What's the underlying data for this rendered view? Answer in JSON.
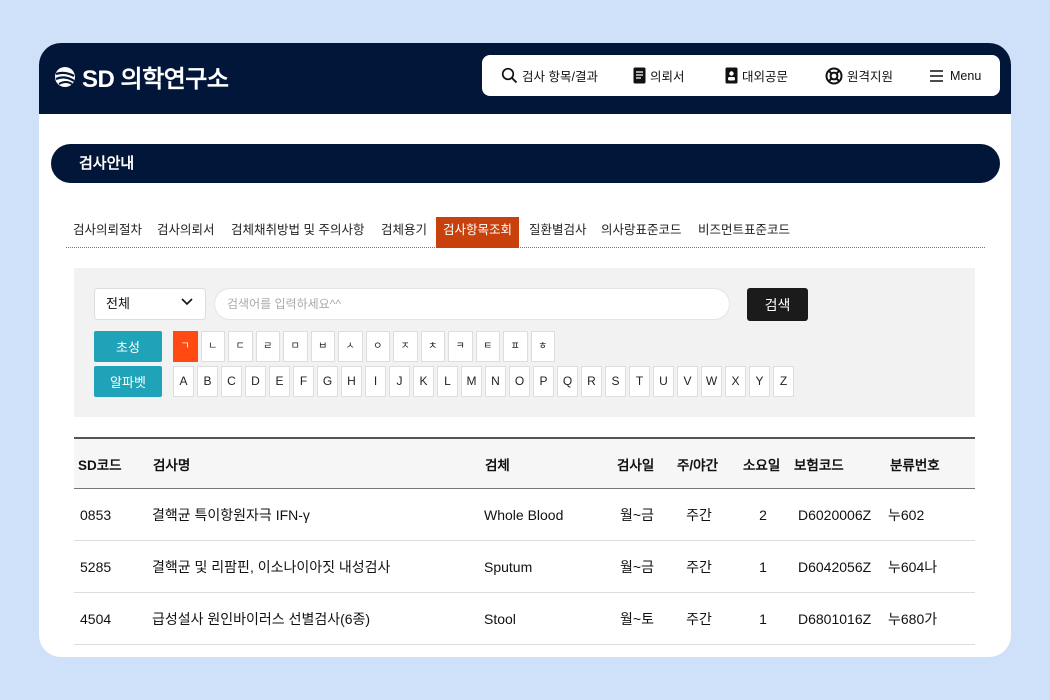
{
  "brand": {
    "name": "SD 의학연구소"
  },
  "nav": {
    "items": [
      {
        "label": "검사 항목/결과",
        "icon": "search-icon"
      },
      {
        "label": "의뢰서",
        "icon": "document-icon"
      },
      {
        "label": "대외공문",
        "icon": "badge-icon"
      },
      {
        "label": "원격지원",
        "icon": "lifebuoy-icon"
      },
      {
        "label": "Menu",
        "icon": "hamburger-menu-icon"
      }
    ]
  },
  "section_title": "검사안내",
  "tabs": [
    {
      "label": "검사의뢰절차"
    },
    {
      "label": "검사의뢰서"
    },
    {
      "label": "검체채취방법 및 주의사항"
    },
    {
      "label": "검체용기"
    },
    {
      "label": "검사항목조회",
      "active": true
    },
    {
      "label": "질환별검사"
    },
    {
      "label": "의사랑표준코드"
    },
    {
      "label": "비즈먼트표준코드"
    }
  ],
  "search": {
    "category_selected": "전체",
    "placeholder": "검색어를 입력하세요^^",
    "value": "",
    "button_label": "검색"
  },
  "filters": {
    "initial_label": "초성",
    "alphabet_label": "알파벳",
    "consonants": [
      "ㄱ",
      "ㄴ",
      "ㄷ",
      "ㄹ",
      "ㅁ",
      "ㅂ",
      "ㅅ",
      "ㅇ",
      "ㅈ",
      "ㅊ",
      "ㅋ",
      "ㅌ",
      "ㅍ",
      "ㅎ"
    ],
    "active_consonant": "ㄱ",
    "letters": [
      "A",
      "B",
      "C",
      "D",
      "E",
      "F",
      "G",
      "H",
      "I",
      "J",
      "K",
      "L",
      "M",
      "N",
      "O",
      "P",
      "Q",
      "R",
      "S",
      "T",
      "U",
      "V",
      "W",
      "X",
      "Y",
      "Z"
    ]
  },
  "table": {
    "headers": {
      "code": "SD코드",
      "name": "검사명",
      "specimen": "검체",
      "test_day": "검사일",
      "shift": "주/야간",
      "duration": "소요일",
      "insurance": "보험코드",
      "category": "분류번호"
    },
    "rows": [
      {
        "code": "0853",
        "name": "결핵균 특이항원자극 IFN-γ",
        "specimen": "Whole Blood",
        "test_day": "월~금",
        "shift": "주간",
        "duration": "2",
        "insurance": "D6020006Z",
        "category": "누602"
      },
      {
        "code": "5285",
        "name": "결핵균 및 리팜핀, 이소나이아짓 내성검사",
        "specimen": "Sputum",
        "test_day": "월~금",
        "shift": "주간",
        "duration": "1",
        "insurance": "D6042056Z",
        "category": "누604나"
      },
      {
        "code": "4504",
        "name": "급성설사 원인바이러스 선별검사(6종)",
        "specimen": "Stool",
        "test_day": "월~토",
        "shift": "주간",
        "duration": "1",
        "insurance": "D6801016Z",
        "category": "누680가"
      }
    ]
  },
  "colors": {
    "page_bg": "#cfe1f8",
    "navy": "#011638",
    "active_tab": "#c8410c",
    "active_letter": "#ff4b12",
    "teal_button": "#1fa3b8"
  }
}
